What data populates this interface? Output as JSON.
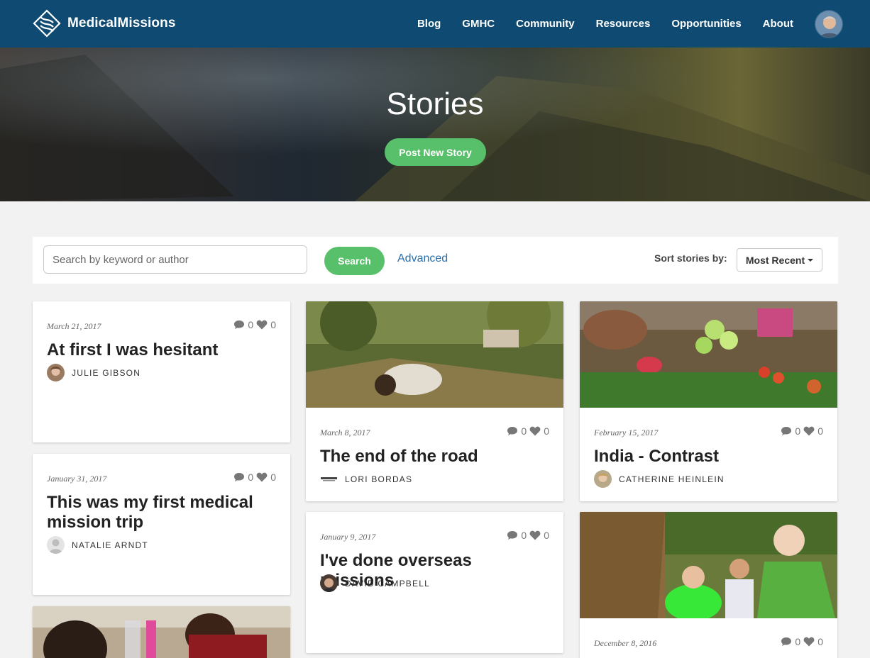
{
  "brand": {
    "name": "MedicalMissions"
  },
  "nav": {
    "links": [
      "Blog",
      "GMHC",
      "Community",
      "Resources",
      "Opportunities",
      "About"
    ]
  },
  "hero": {
    "title": "Stories",
    "button": "Post New Story"
  },
  "search": {
    "placeholder": "Search by keyword or author",
    "button": "Search",
    "advanced": "Advanced",
    "sort_label": "Sort stories by:",
    "sort_value": "Most Recent"
  },
  "stories": [
    {
      "date": "March 21, 2017",
      "comments": "0",
      "likes": "0",
      "title": "At first I was hesitant",
      "author": "JULIE GIBSON"
    },
    {
      "date": "January 31, 2017",
      "comments": "0",
      "likes": "0",
      "title": "This was my first medical mission trip",
      "author": "NATALIE ARNDT"
    },
    {
      "date": "March 8, 2017",
      "comments": "0",
      "likes": "0",
      "title": "The end of the road",
      "author": "LORI BORDAS"
    },
    {
      "date": "January 9, 2017",
      "comments": "0",
      "likes": "0",
      "title": "I've done overseas missions",
      "author": "DAVID CAMPBELL"
    },
    {
      "date": "February 15, 2017",
      "comments": "0",
      "likes": "0",
      "title": "India - Contrast",
      "author": "CATHERINE HEINLEIN"
    },
    {
      "date": "December 8, 2016",
      "comments": "0",
      "likes": "0"
    }
  ],
  "colors": {
    "nav": "#0e4a72",
    "accent": "#58c06a",
    "link": "#2a6fad"
  }
}
